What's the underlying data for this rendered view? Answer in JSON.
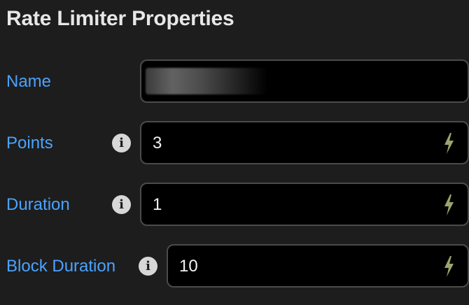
{
  "panel": {
    "title": "Rate Limiter Properties"
  },
  "fields": {
    "name": {
      "label": "Name",
      "value": ""
    },
    "points": {
      "label": "Points",
      "info_icon": "info-icon",
      "value": "3",
      "action_icon": "lightning-bolt-icon"
    },
    "duration": {
      "label": "Duration",
      "info_icon": "info-icon",
      "value": "1",
      "action_icon": "lightning-bolt-icon"
    },
    "block_duration": {
      "label": "Block Duration",
      "info_icon": "info-icon",
      "value": "10",
      "action_icon": "lightning-bolt-icon"
    }
  },
  "colors": {
    "background": "#1d1d1d",
    "label": "#4aa3ff",
    "field_background": "#000000",
    "field_border": "#4b4b4b",
    "bolt": "#9aa56b",
    "info_icon": "#d7d7d7"
  }
}
